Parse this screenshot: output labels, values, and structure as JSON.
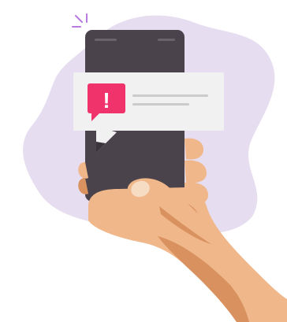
{
  "illustration": {
    "subject": "hand-holding-smartphone-with-alert-notification",
    "alert_symbol": "!"
  },
  "colors": {
    "background": "#ffffff",
    "blob": "#e6ddf0",
    "sparkle": "#b77be0",
    "phone_body": "#4a434c",
    "phone_detail": "#6a636c",
    "notification_card": "#f1f1f1",
    "notification_shadow": "#3a343c",
    "alert_badge": "#f0336b",
    "alert_glyph": "#ffffff",
    "text_line": "#cbcbcb",
    "skin": "#f0b78a",
    "skin_shadow": "#d9915f",
    "skin_light": "#f6c9a1",
    "thumbnail": "#f7dcc4"
  }
}
